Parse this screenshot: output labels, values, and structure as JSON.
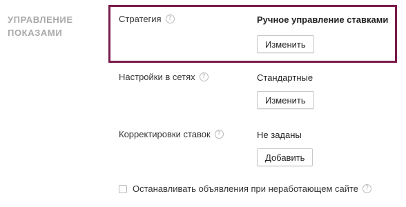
{
  "section": {
    "title": "Управление показами"
  },
  "rows": {
    "strategy": {
      "label": "Стратегия",
      "value": "Ручное управление ставками",
      "button": "Изменить"
    },
    "networks": {
      "label": "Настройки в сетях",
      "value": "Стандартные",
      "button": "Изменить"
    },
    "bid_adjustments": {
      "label": "Корректировки ставок",
      "value": "Не заданы",
      "button": "Добавить"
    }
  },
  "checkbox": {
    "label": "Останавливать объявления при неработающем сайте",
    "checked": false
  },
  "help_icon_glyph": "?",
  "colors": {
    "highlight": "#7a1a4a",
    "section_title": "#a8a8a8"
  }
}
